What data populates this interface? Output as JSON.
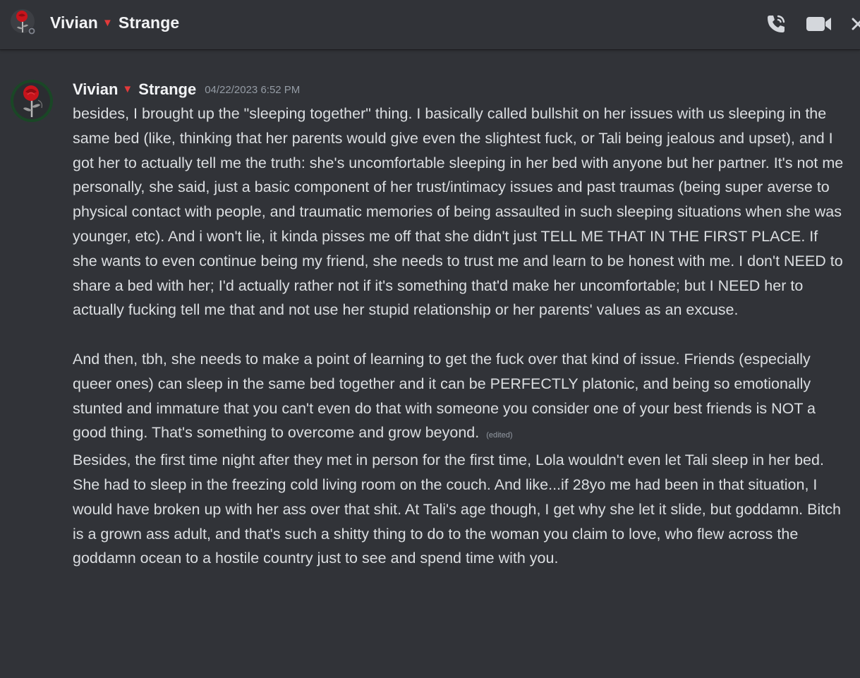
{
  "header": {
    "name_first": "Vivian",
    "name_mark": "▼",
    "name_last": "Strange",
    "icons": [
      "rose-avatar-icon",
      "phone-call-icon",
      "video-call-icon",
      "close-icon"
    ]
  },
  "message": {
    "author_first": "Vivian",
    "author_mark": "▼",
    "author_last": "Strange",
    "timestamp": "04/22/2023 6:52 PM",
    "paragraph_1": "besides, I brought up the \"sleeping together\" thing. I basically called bullshit on her issues with us sleeping in the same bed (like, thinking that her parents would give even the slightest fuck, or Tali being jealous and upset), and I got her to actually tell me the truth: she's uncomfortable sleeping in her bed with anyone but her partner. It's not me personally, she said, just a basic component of her trust/intimacy issues and past traumas (being super averse to physical contact with people, and traumatic memories of being assaulted in such sleeping situations when she was younger, etc). And i won't lie, it kinda pisses me off that she didn't just TELL ME THAT IN THE FIRST PLACE. If she wants to even continue being my friend, she needs to trust me and learn to be honest with me. I don't NEED to share a bed with her; I'd actually rather not if it's something that'd make her uncomfortable; but I NEED her to actually fucking tell me that and not use her stupid relationship or her parents' values as an excuse.",
    "paragraph_2": "And then, tbh, she needs to make a point of learning to get the fuck over that kind of issue. Friends (especially queer ones) can sleep in the same bed together and it can be PERFECTLY platonic, and being so emotionally stunted and immature that you can't even do that with someone you consider one of your best friends is NOT a good thing. That's something to overcome and grow beyond.",
    "edited_label": "(edited)",
    "paragraph_3": "Besides, the first time night after they met in person for the first time, Lola wouldn't even let Tali sleep in her bed. She had to sleep in the freezing cold living room on the couch. And like...if 28yo me had been in that situation, I would have broken up with her ass over that shit. At Tali's age though, I get why she let it slide, but goddamn. Bitch is a grown ass adult, and that's such a shitty thing to do to the woman you claim to love, who flew across the goddamn ocean to a hostile country just to see and spend time with you."
  },
  "colors": {
    "background": "#313338",
    "text": "#dbdee1",
    "name": "#f2f3f5",
    "muted": "#949ba4",
    "heart": "#e23a3a"
  }
}
